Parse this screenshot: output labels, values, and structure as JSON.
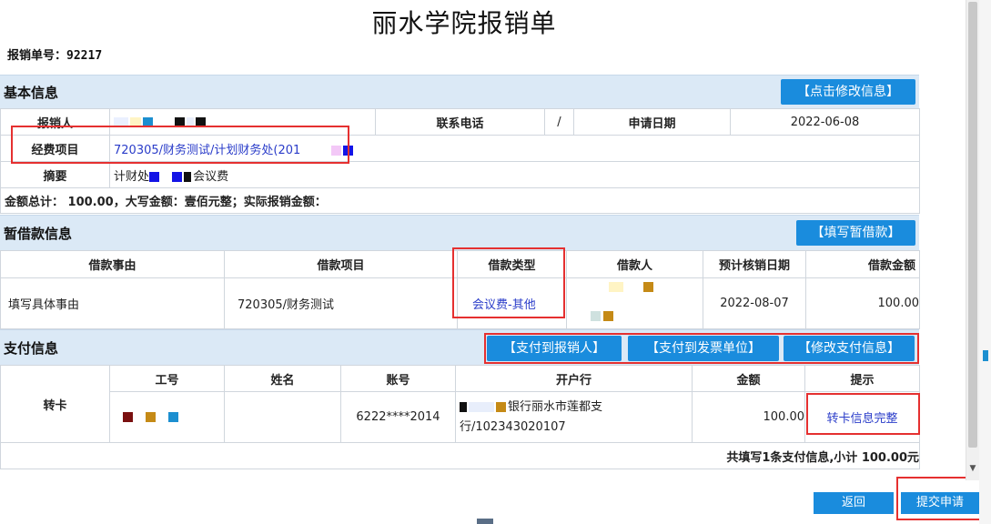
{
  "title": "丽水学院报销单",
  "form_number": {
    "label": "报销单号：",
    "value": "92217"
  },
  "basic_info": {
    "title": "基本信息",
    "edit_button": "【点击修改信息】",
    "reimburser_label": "报销人",
    "phone_label": "联系电话",
    "phone_value": "/",
    "apply_date_label": "申请日期",
    "apply_date_value": "2022-06-08",
    "project_label": "经费项目",
    "project_value": "720305/财务测试/计划财务处(201",
    "summary_label": "摘要",
    "summary_value_a": "计财处",
    "summary_value_b": "会议费",
    "total_line": "金额总计： 100.00，大写金额：壹佰元整；实际报销金额："
  },
  "loan_info": {
    "title": "暂借款信息",
    "fill_button": "【填写暂借款】",
    "headers": [
      "借款事由",
      "借款项目",
      "借款类型",
      "借款人",
      "预计核销日期",
      "借款金额"
    ],
    "row": {
      "reason": "填写具体事由",
      "project": "720305/财务测试",
      "type": "会议费-其他",
      "date": "2022-08-07",
      "amount": "100.00"
    }
  },
  "payment_info": {
    "title": "支付信息",
    "buttons": [
      "【支付到报销人】",
      "【支付到发票单位】",
      "【修改支付信息】"
    ],
    "headers": [
      "工号",
      "姓名",
      "账号",
      "开户行",
      "金额",
      "提示"
    ],
    "method": "转卡",
    "row": {
      "account": "6222****2014",
      "bank_line1": "银行丽水市莲都支",
      "bank_line2": "行/102343020107",
      "amount": "100.00",
      "hint": "转卡信息完整"
    },
    "summary": "共填写1条支付信息,小计 100.00元"
  },
  "actions": {
    "back": "返回",
    "submit": "提交申请"
  },
  "colors": {
    "accent": "#1a8cdd",
    "section_bg": "#dbe9f6",
    "link": "#2a3cc9",
    "highlight": "#e53030"
  }
}
